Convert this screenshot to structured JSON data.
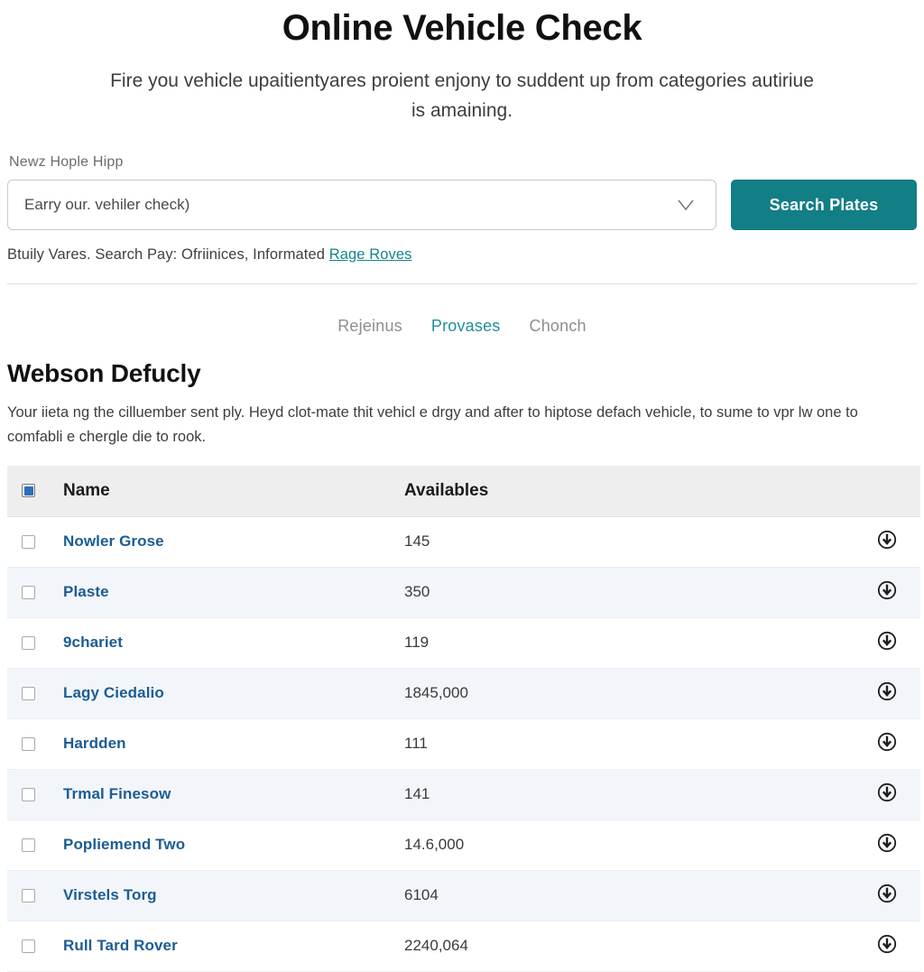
{
  "hero": {
    "title": "Online Vehicle Check",
    "subtitle": "Fire you vehicle upaitientyares proient enjony to suddent up from categories autiriue is amaining."
  },
  "search": {
    "label": "Newz Hople Hipp",
    "select_value": "Earry our. vehiler check)",
    "chevron_icon": "chevron-down-icon",
    "button_label": "Search Plates",
    "button_color": "#127e85",
    "helper_text": "Btuily Vares. Search Pay: Ofriinices, Informated ",
    "helper_link": "Rage Roves",
    "link_color": "#16848c"
  },
  "tabs": [
    {
      "label": "Rejeinus",
      "active": false
    },
    {
      "label": "Provases",
      "active": true
    },
    {
      "label": "Chonch",
      "active": false
    }
  ],
  "section": {
    "title": "Webson Defucly",
    "body": "Your iieta ng the cilluember sent ply. Heyd clot-mate thit vehicl e drgy and after to hiptose defach vehicle, to sume to vpr lw one to comfabli e chergle die to rook."
  },
  "table": {
    "header": {
      "select_all_checked": true,
      "name": "Name",
      "availables": "Availables"
    },
    "action_icon": "circle-plus-icon",
    "rows": [
      {
        "checked": false,
        "name": "Nowler Grose",
        "availables": "145"
      },
      {
        "checked": false,
        "name": "Plaste",
        "availables": "350"
      },
      {
        "checked": false,
        "name": "9chariet",
        "availables": "119"
      },
      {
        "checked": false,
        "name": "Lagy Ciedalio",
        "availables": "1845,000"
      },
      {
        "checked": false,
        "name": "Hardden",
        "availables": "111"
      },
      {
        "checked": false,
        "name": "Trmal Finesow",
        "availables": "141"
      },
      {
        "checked": false,
        "name": "Popliemend Two",
        "availables": "14.6,000"
      },
      {
        "checked": false,
        "name": "Virstels Torg",
        "availables": "6104"
      },
      {
        "checked": false,
        "name": "Rull Tard Rover",
        "availables": "2240,064"
      }
    ]
  }
}
